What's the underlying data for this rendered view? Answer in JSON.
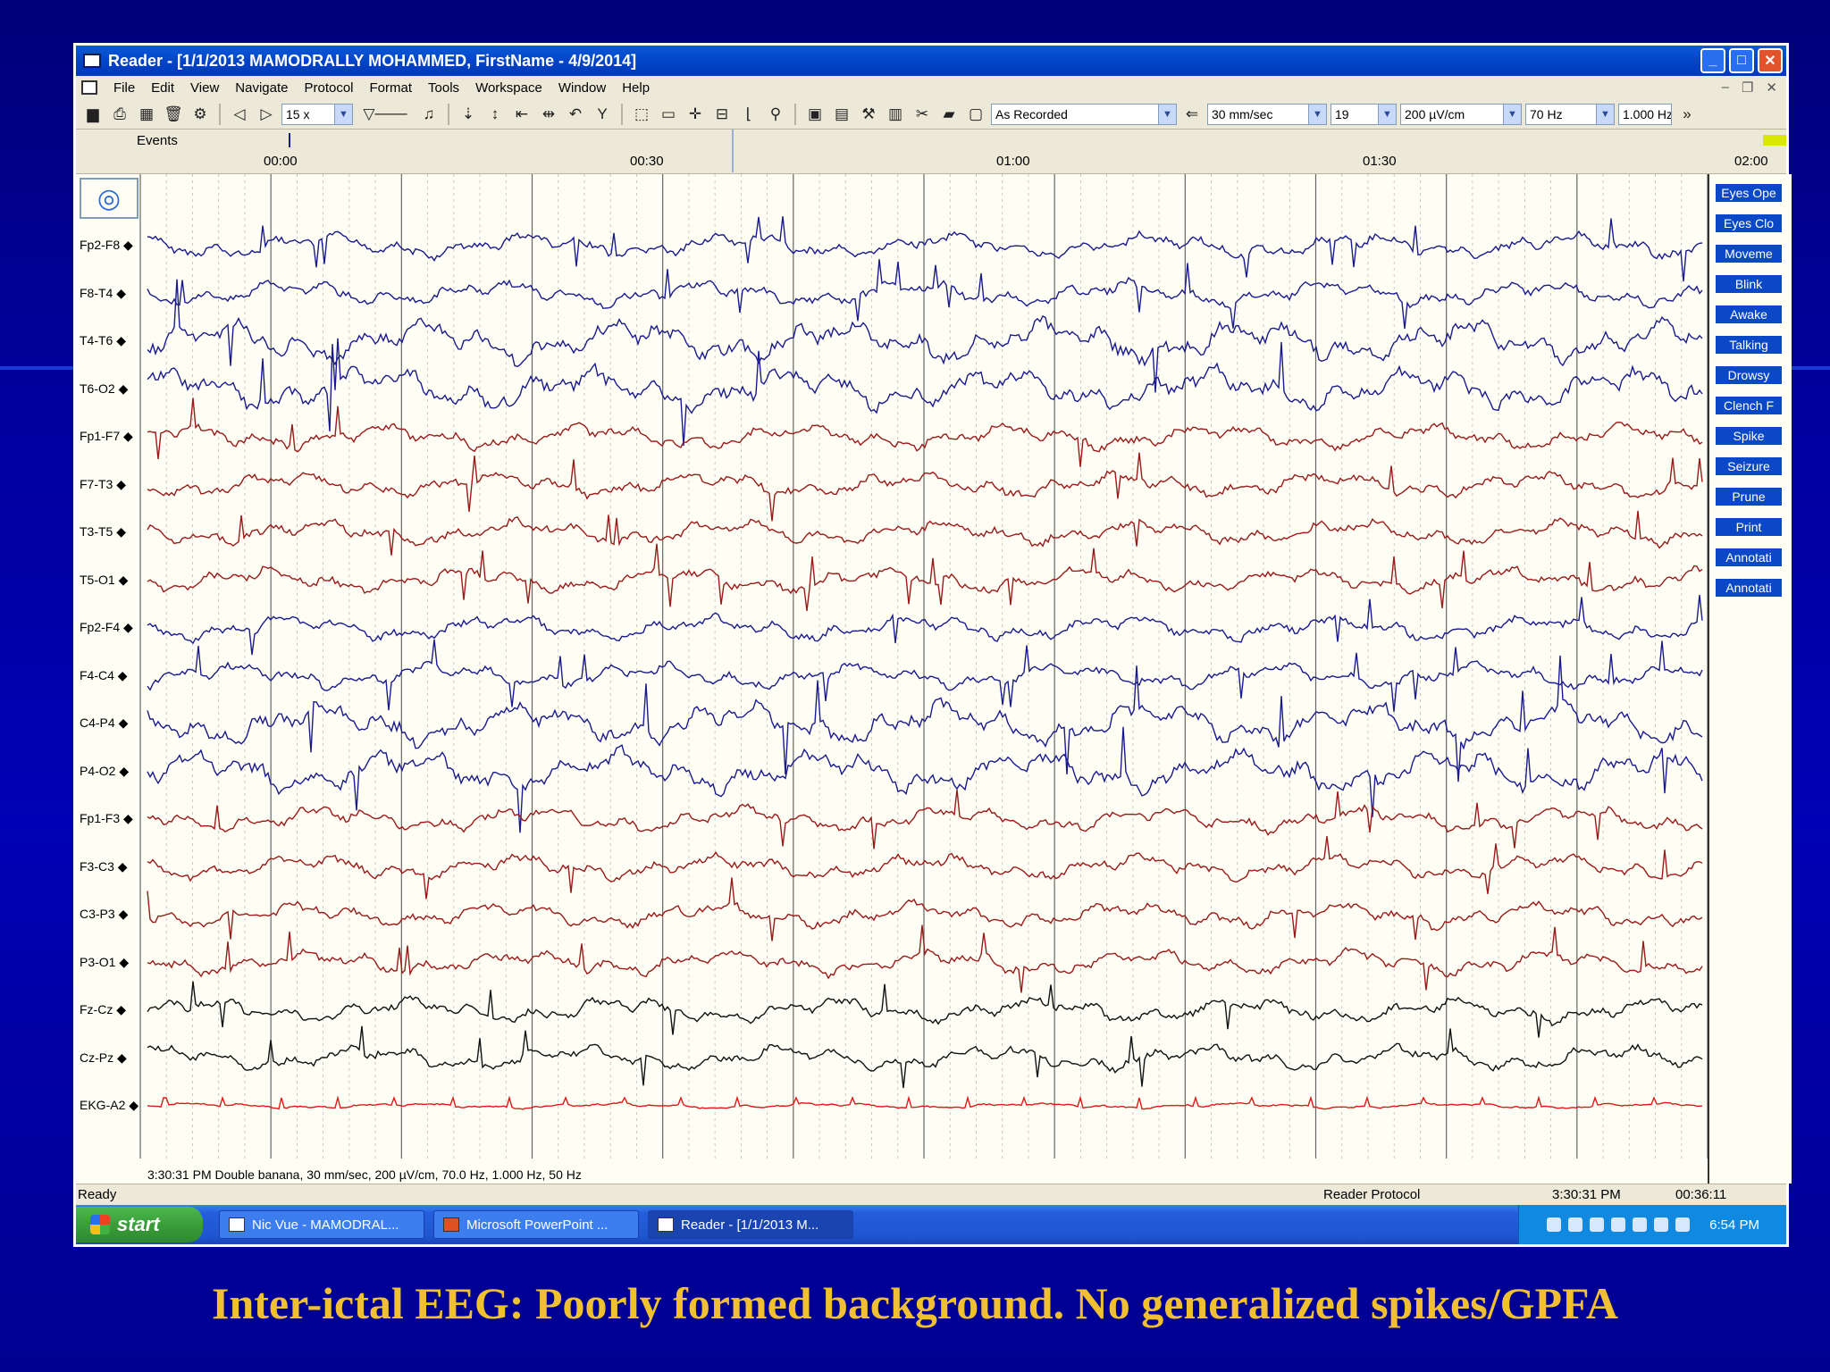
{
  "window": {
    "title": "Reader - [1/1/2013 MAMODRALLY MOHAMMED, FirstName - 4/9/2014]",
    "minimize": "_",
    "maximize": "□",
    "close": "✕"
  },
  "menu": [
    "File",
    "Edit",
    "View",
    "Navigate",
    "Protocol",
    "Format",
    "Tools",
    "Workspace",
    "Window",
    "Help"
  ],
  "toolbar": {
    "zoom": "15 x",
    "protocol": "As Recorded",
    "speed": "30 mm/sec",
    "channels": "19",
    "sensitivity": "200 µV/cm",
    "high_filter": "70 Hz",
    "low_filter": "1.000 Hz",
    "more": "»"
  },
  "timeline": {
    "events_label": "Events",
    "ticks": [
      "00:00",
      "00:30",
      "01:00",
      "01:30",
      "02:00"
    ]
  },
  "channels": [
    {
      "label": "Fp2-F8",
      "color": "#1a1a8e"
    },
    {
      "label": "F8-T4",
      "color": "#1a1a8e"
    },
    {
      "label": "T4-T6",
      "color": "#1a1a8e"
    },
    {
      "label": "T6-O2",
      "color": "#1a1a8e"
    },
    {
      "label": "Fp1-F7",
      "color": "#9a1a1a"
    },
    {
      "label": "F7-T3",
      "color": "#9a1a1a"
    },
    {
      "label": "T3-T5",
      "color": "#9a1a1a"
    },
    {
      "label": "T5-O1",
      "color": "#9a1a1a"
    },
    {
      "label": "Fp2-F4",
      "color": "#1a1a8e"
    },
    {
      "label": "F4-C4",
      "color": "#1a1a8e"
    },
    {
      "label": "C4-P4",
      "color": "#1a1a8e"
    },
    {
      "label": "P4-O2",
      "color": "#1a1a8e"
    },
    {
      "label": "Fp1-F3",
      "color": "#9a1a1a"
    },
    {
      "label": "F3-C3",
      "color": "#9a1a1a"
    },
    {
      "label": "C3-P3",
      "color": "#9a1a1a"
    },
    {
      "label": "P3-O1",
      "color": "#9a1a1a"
    },
    {
      "label": "Fz-Cz",
      "color": "#111111"
    },
    {
      "label": "Cz-Pz",
      "color": "#111111"
    },
    {
      "label": "EKG-A2",
      "color": "#e01818"
    }
  ],
  "eeg_info": "3:30:31 PM Double banana, 30 mm/sec, 200 µV/cm, 70.0 Hz, 1.000 Hz, 50 Hz",
  "event_buttons": [
    "Eyes Ope",
    "Eyes Clo",
    "Moveme",
    "Blink",
    "Awake",
    "Talking",
    "Drowsy",
    "Clench F",
    "Spike",
    "Seizure",
    "Prune",
    "Print",
    "Annotati",
    "Annotati"
  ],
  "status": {
    "ready": "Ready",
    "protocol": "Reader Protocol",
    "clock": "3:30:31 PM",
    "elapsed": "00:36:11"
  },
  "taskbar": {
    "start": "start",
    "items": [
      "Nic Vue - MAMODRAL...",
      "Microsoft PowerPoint ...",
      "Reader - [1/1/2013 M..."
    ],
    "time": "6:54 PM"
  },
  "caption": "Inter-ictal  EEG: Poorly formed background. No generalized spikes/GPFA"
}
